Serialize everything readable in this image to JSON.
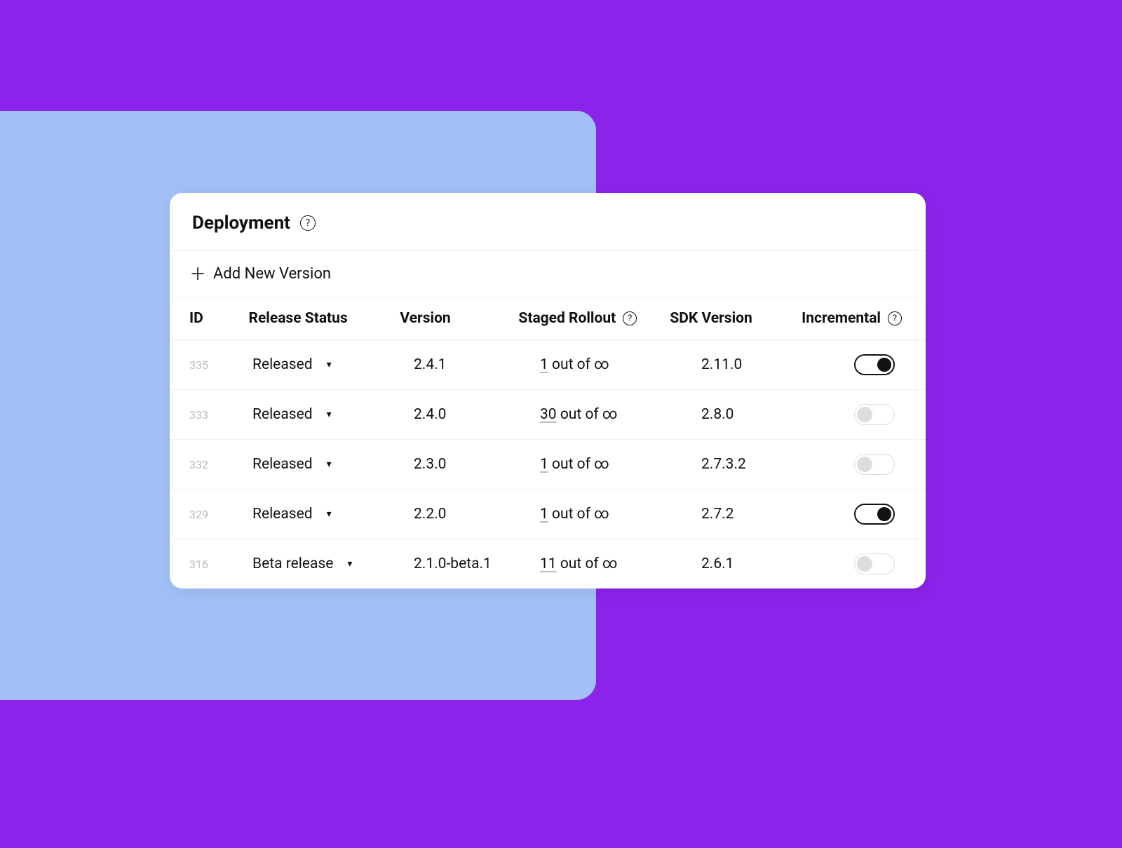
{
  "header": {
    "title": "Deployment"
  },
  "actions": {
    "add_label": "Add New Version"
  },
  "columns": {
    "id": "ID",
    "status": "Release Status",
    "version": "Version",
    "rollout": "Staged Rollout",
    "sdk": "SDK Version",
    "incremental": "Incremental"
  },
  "rows": [
    {
      "id": "335",
      "status": "Released",
      "version": "2.4.1",
      "rollout_n": "1",
      "rollout_suffix": "out of ∞",
      "sdk": "2.11.0",
      "incremental": true
    },
    {
      "id": "333",
      "status": "Released",
      "version": "2.4.0",
      "rollout_n": "30",
      "rollout_suffix": "out of ∞",
      "sdk": "2.8.0",
      "incremental": false
    },
    {
      "id": "332",
      "status": "Released",
      "version": "2.3.0",
      "rollout_n": "1",
      "rollout_suffix": "out of ∞",
      "sdk": "2.7.3.2",
      "incremental": false
    },
    {
      "id": "329",
      "status": "Released",
      "version": "2.2.0",
      "rollout_n": "1",
      "rollout_suffix": "out of ∞",
      "sdk": "2.7.2",
      "incremental": true
    },
    {
      "id": "316",
      "status": "Beta release",
      "version": "2.1.0-beta.1",
      "rollout_n": "11",
      "rollout_suffix": "out of ∞",
      "sdk": "2.6.1",
      "incremental": false
    }
  ]
}
